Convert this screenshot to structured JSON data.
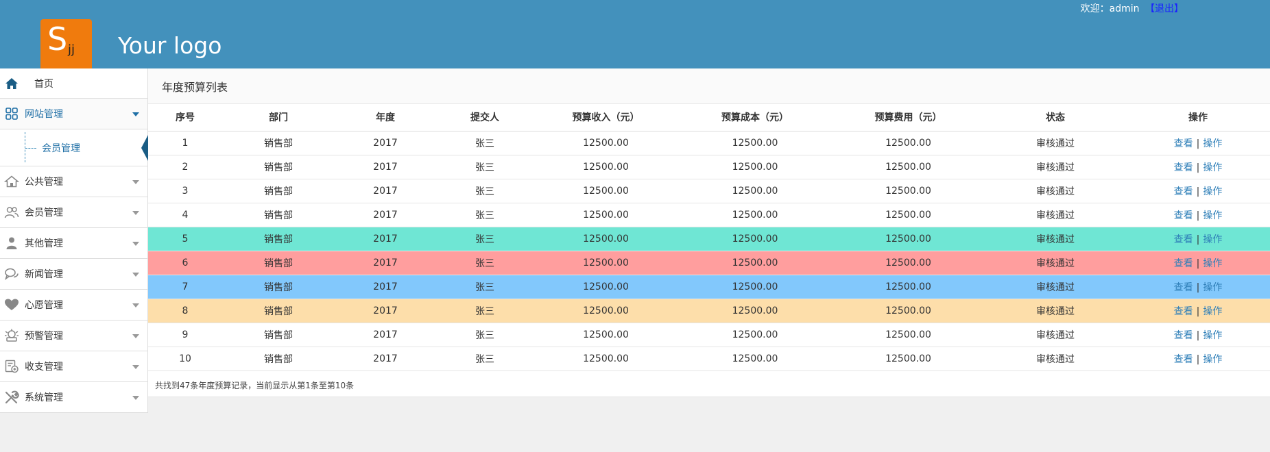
{
  "header": {
    "logo_letter": "S",
    "logo_sub": "jj",
    "logo_text": "Your logo",
    "welcome": "欢迎：admin",
    "logout": "【退出】",
    "colors": {
      "bar": "#4391bc",
      "logo": "#f07b0d"
    }
  },
  "sidebar": {
    "home": {
      "label": "首页",
      "icon": "home-icon"
    },
    "groups": [
      {
        "label": "网站管理",
        "icon": "grid-icon",
        "active": true,
        "children": [
          {
            "label": "会员管理"
          }
        ]
      },
      {
        "label": "公共管理",
        "icon": "house-icon"
      },
      {
        "label": "会员管理",
        "icon": "users-icon"
      },
      {
        "label": "其他管理",
        "icon": "person-icon"
      },
      {
        "label": "新闻管理",
        "icon": "chat-icon"
      },
      {
        "label": "心愿管理",
        "icon": "heart-icon"
      },
      {
        "label": "预警管理",
        "icon": "alarm-icon"
      },
      {
        "label": "收支管理",
        "icon": "ledger-icon"
      },
      {
        "label": "系统管理",
        "icon": "tools-icon"
      }
    ]
  },
  "main": {
    "title": "年度预算列表",
    "columns": [
      "序号",
      "部门",
      "年度",
      "提交人",
      "预算收入（元）",
      "预算成本（元）",
      "预算费用（元）",
      "状态",
      "操作"
    ],
    "rows": [
      {
        "no": "1",
        "dept": "销售部",
        "year": "2017",
        "submitter": "张三",
        "income": "12500.00",
        "cost": "12500.00",
        "expense": "12500.00",
        "status": "审核通过",
        "view": "查看",
        "action": "操作",
        "bg": "#ffffff"
      },
      {
        "no": "2",
        "dept": "销售部",
        "year": "2017",
        "submitter": "张三",
        "income": "12500.00",
        "cost": "12500.00",
        "expense": "12500.00",
        "status": "审核通过",
        "view": "查看",
        "action": "操作",
        "bg": "#ffffff"
      },
      {
        "no": "3",
        "dept": "销售部",
        "year": "2017",
        "submitter": "张三",
        "income": "12500.00",
        "cost": "12500.00",
        "expense": "12500.00",
        "status": "审核通过",
        "view": "查看",
        "action": "操作",
        "bg": "#ffffff"
      },
      {
        "no": "4",
        "dept": "销售部",
        "year": "2017",
        "submitter": "张三",
        "income": "12500.00",
        "cost": "12500.00",
        "expense": "12500.00",
        "status": "审核通过",
        "view": "查看",
        "action": "操作",
        "bg": "#ffffff"
      },
      {
        "no": "5",
        "dept": "销售部",
        "year": "2017",
        "submitter": "张三",
        "income": "12500.00",
        "cost": "12500.00",
        "expense": "12500.00",
        "status": "审核通过",
        "view": "查看",
        "action": "操作",
        "bg": "#6fe6d4"
      },
      {
        "no": "6",
        "dept": "销售部",
        "year": "2017",
        "submitter": "张三",
        "income": "12500.00",
        "cost": "12500.00",
        "expense": "12500.00",
        "status": "审核通过",
        "view": "查看",
        "action": "操作",
        "bg": "#ff9e9e"
      },
      {
        "no": "7",
        "dept": "销售部",
        "year": "2017",
        "submitter": "张三",
        "income": "12500.00",
        "cost": "12500.00",
        "expense": "12500.00",
        "status": "审核通过",
        "view": "查看",
        "action": "操作",
        "bg": "#82c8fc"
      },
      {
        "no": "8",
        "dept": "销售部",
        "year": "2017",
        "submitter": "张三",
        "income": "12500.00",
        "cost": "12500.00",
        "expense": "12500.00",
        "status": "审核通过",
        "view": "查看",
        "action": "操作",
        "bg": "#fddeaa"
      },
      {
        "no": "9",
        "dept": "销售部",
        "year": "2017",
        "submitter": "张三",
        "income": "12500.00",
        "cost": "12500.00",
        "expense": "12500.00",
        "status": "审核通过",
        "view": "查看",
        "action": "操作",
        "bg": "#ffffff"
      },
      {
        "no": "10",
        "dept": "销售部",
        "year": "2017",
        "submitter": "张三",
        "income": "12500.00",
        "cost": "12500.00",
        "expense": "12500.00",
        "status": "审核通过",
        "view": "查看",
        "action": "操作",
        "bg": "#ffffff"
      }
    ],
    "footer": "共找到47条年度预算记录，当前显示从第1条至第10条"
  }
}
